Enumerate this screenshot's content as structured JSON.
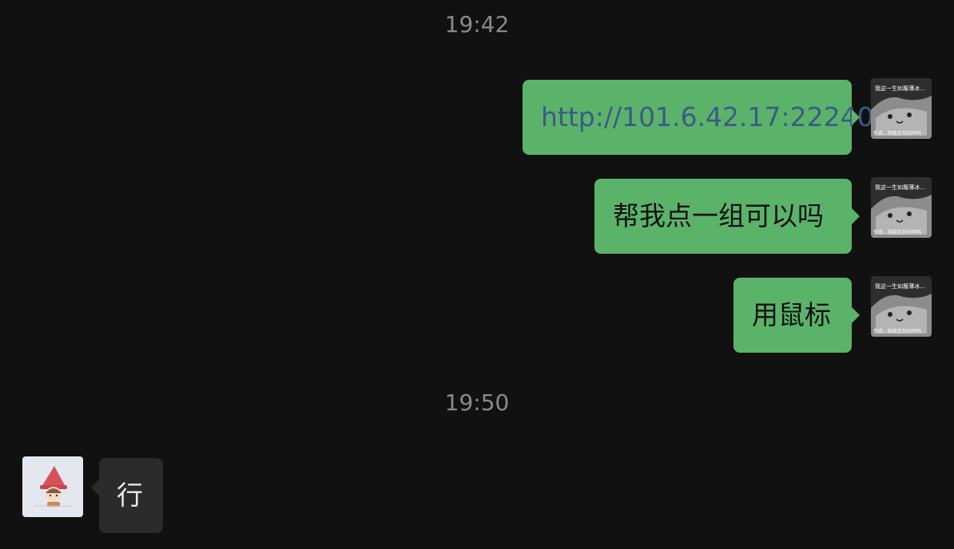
{
  "timestamps": [
    "19:42",
    "19:50"
  ],
  "messages": [
    {
      "side": "outgoing",
      "text": "http://101.6.42.17:22240",
      "is_link": true
    },
    {
      "side": "outgoing",
      "text": "帮我点一组可以吗"
    },
    {
      "side": "outgoing",
      "text": "用鼠标"
    },
    {
      "side": "incoming",
      "text": "行"
    }
  ],
  "avatars": {
    "self": {
      "icon": "cartoon-face-avatar-icon",
      "caption_top": "我这一生如履薄冰…",
      "caption_bottom": "你说…我能走到对岸吗"
    },
    "contact": {
      "icon": "cartoon-girl-avatar-icon"
    }
  },
  "colors": {
    "background": "#111111",
    "outgoing_bubble": "#5bb36a",
    "incoming_bubble": "#2b2b2b",
    "link": "#3d5a86",
    "timestamp": "#8a8a8a"
  }
}
